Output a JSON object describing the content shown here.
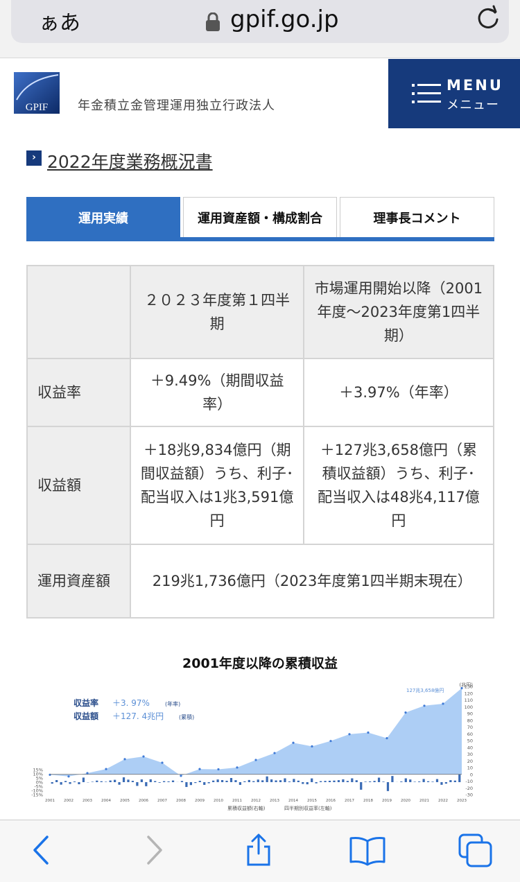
{
  "browser": {
    "aa_label": "ぁあ",
    "url": "gpif.go.jp"
  },
  "header": {
    "logo_text": "GPIF",
    "org_name": "年金積立金管理運用独立行政法人",
    "menu_en": "MENU",
    "menu_jp": "メニュー"
  },
  "page": {
    "title": "2022年度業務概況書"
  },
  "tabs": [
    {
      "label": "運用実績",
      "active": true
    },
    {
      "label": "運用資産額・構成割合",
      "active": false
    },
    {
      "label": "理事長コメント",
      "active": false
    }
  ],
  "table": {
    "col1_header": "２０２３年度第１四半期",
    "col2_header": "市場運用開始以降（2001年度～2023年度第1四半期）",
    "rows": [
      {
        "label": "収益率",
        "col1": "＋9.49%（期間収益率）",
        "col2": "＋3.97%（年率）"
      },
      {
        "label": "収益額",
        "col1": "＋18兆9,834億円（期間収益額）うち、利子･配当収入は1兆3,591億円",
        "col2": "＋127兆3,658億円（累積収益額）うち、利子･配当収入は48兆4,117億円"
      },
      {
        "label": "運用資産額",
        "span": "219兆1,736億円（2023年度第1四半期末現在）"
      }
    ]
  },
  "chart_data": {
    "type": "area",
    "title": "2001年度以降の累積収益",
    "summary_rate_label": "収益率",
    "summary_rate_value": "＋3. 97%",
    "summary_rate_note": "(年率)",
    "summary_amount_label": "収益額",
    "summary_amount_value": "＋127. 4兆円",
    "summary_amount_note": "(累積)",
    "annotation": "127兆3,658億円",
    "right_axis_unit": "(兆円)",
    "right_ylim": [
      -30,
      130
    ],
    "right_ticks": [
      130,
      120,
      110,
      100,
      90,
      80,
      70,
      60,
      50,
      40,
      30,
      20,
      10,
      0,
      -10,
      -20,
      -30
    ],
    "left_ylim": [
      -15,
      15
    ],
    "left_ticks": [
      "15%",
      "10%",
      "5%",
      "0%",
      "-5%",
      "-10%",
      "-15%"
    ],
    "x_labels": [
      "2001",
      "2002",
      "2003",
      "2004",
      "2005",
      "2006",
      "2007",
      "2008",
      "2009",
      "2010",
      "2011",
      "2012",
      "2013",
      "2014",
      "2015",
      "2016",
      "2017",
      "2018",
      "2019",
      "2020",
      "2021",
      "2022",
      "2023"
    ],
    "series": [
      {
        "name": "累積収益額(右軸)",
        "x": [
          2001,
          2002,
          2003,
          2004,
          2005,
          2006,
          2007,
          2008,
          2009,
          2010,
          2011,
          2012,
          2013,
          2014,
          2015,
          2016,
          2017,
          2018,
          2019,
          2020,
          2021,
          2022,
          2023
        ],
        "values": [
          -0.6,
          -3.1,
          1.8,
          7.8,
          22.5,
          26.4,
          17.2,
          -2.2,
          7.8,
          7.5,
          10.1,
          21.3,
          31.5,
          46.7,
          41.4,
          49.3,
          59.4,
          61.8,
          53.5,
          91.4,
          101.5,
          104.5,
          127.4
        ],
        "color": "#9fc6f3"
      },
      {
        "name": "四半期別収益率(左軸)",
        "values": [
          -1.8,
          2.5,
          -3.0,
          1.4,
          -2.1,
          0.8,
          -2.5,
          5.5,
          -0.3,
          0.5,
          1.9,
          1.1,
          0.5,
          2.0,
          2.8,
          -3.1,
          5.8,
          3.0,
          1.6,
          -4.5,
          3.3,
          -4.9,
          3.4,
          1.3,
          -0.7,
          1.2,
          0.9,
          2.0,
          0.1,
          1.4,
          -5.8,
          -3.5,
          -1.0,
          1.6,
          -3.3,
          -1.3,
          1.9,
          3.2,
          2.5,
          1.7,
          5.0,
          2.4,
          -3.3,
          1.0,
          2.6,
          1.2,
          3.1,
          2.2,
          6.9,
          3.3,
          2.1,
          2.3,
          4.6,
          0.8,
          3.9,
          1.8,
          -2.1,
          -2.6,
          4.5,
          -1.4,
          1.2,
          1.5,
          1.7,
          1.9,
          2.4,
          3.4,
          1.5,
          4.6,
          2.3,
          -9.1,
          0.6,
          0.9,
          1.5,
          5.4,
          0.6,
          -10.7,
          7.4,
          0.1,
          0.8,
          4.6,
          3.2,
          0.5,
          0.8,
          3.8,
          1.1,
          0.6,
          3.7,
          -3.2,
          -1.8,
          2.4,
          1.9,
          9.5
        ],
        "color": "#3a6bb5"
      }
    ],
    "legend": [
      "累積収益額(右軸)",
      "四半期別収益率(左軸)"
    ]
  }
}
